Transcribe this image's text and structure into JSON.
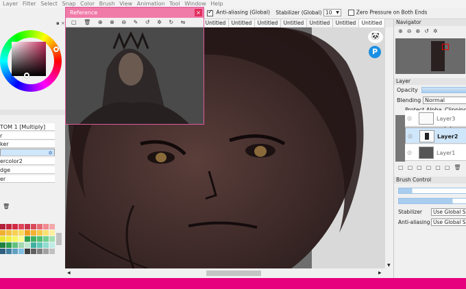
{
  "menubar": {
    "items": [
      "Layer",
      "Filter",
      "Select",
      "Snap",
      "Color",
      "Brush",
      "View",
      "Animation",
      "Tool",
      "Window",
      "Help"
    ]
  },
  "options": {
    "antialias_label": "Anti-aliasing (Global)",
    "stabilizer_label": "Stabilizer (Global)",
    "stabilizer_value": "10",
    "zero_pressure_label": "Zero Pressure on Both Ends"
  },
  "tabs": [
    "Untitled",
    "Untitled",
    "Untitled",
    "Untitled",
    "Untitled",
    "Untitled",
    "Untitled"
  ],
  "reference": {
    "title": "Reference",
    "close": "×"
  },
  "left_layers": [
    {
      "label": "TOM 1 [Multiply]"
    },
    {
      "label": "r"
    },
    {
      "label": "ker"
    },
    {
      "label": ""
    },
    {
      "label": "ercolor2"
    },
    {
      "label": "dge"
    },
    {
      "label": "er"
    }
  ],
  "navigator": {
    "title": "Navigator"
  },
  "layer_panel": {
    "title": "Layer",
    "opacity_label": "Opacity",
    "blending_label": "Blending",
    "blending_value": "Normal",
    "protect_alpha": "Protect Alpha",
    "clipping": "Clipping",
    "layers": [
      {
        "name": "Layer3",
        "selected": false
      },
      {
        "name": "Layer2",
        "selected": true
      },
      {
        "name": "Layer1",
        "selected": false
      }
    ]
  },
  "brush_control": {
    "title": "Brush Control",
    "stabilizer_label": "Stabilizer",
    "stabilizer_value": "Use Global Setting",
    "antialias_label": "Anti-aliasing",
    "antialias_value": "Use Global Setting"
  },
  "colors": {
    "accent": "#e6007e",
    "ref_title": "#f07aa8",
    "canvas": "#3a2a2a",
    "selection": "#cfe6fb"
  }
}
